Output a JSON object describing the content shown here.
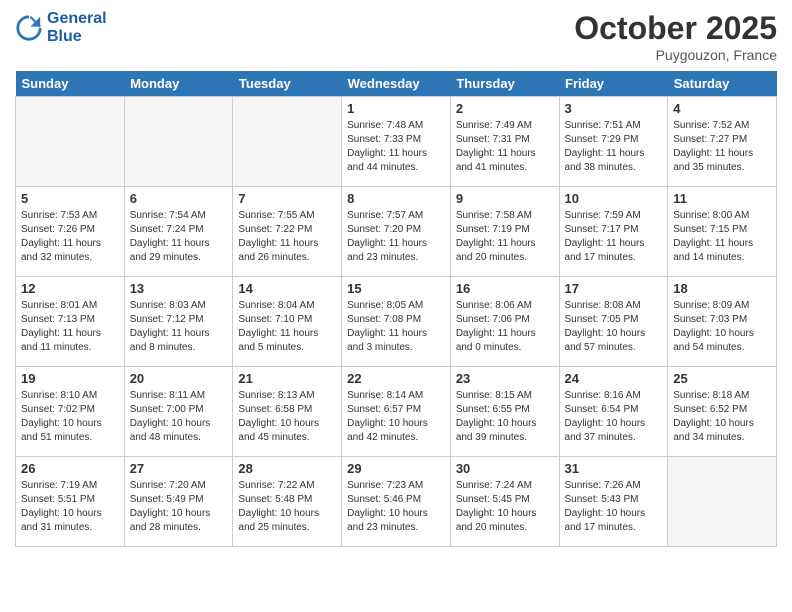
{
  "header": {
    "logo_line1": "General",
    "logo_line2": "Blue",
    "month": "October 2025",
    "location": "Puygouzon, France"
  },
  "days_of_week": [
    "Sunday",
    "Monday",
    "Tuesday",
    "Wednesday",
    "Thursday",
    "Friday",
    "Saturday"
  ],
  "weeks": [
    [
      {
        "day": "",
        "info": ""
      },
      {
        "day": "",
        "info": ""
      },
      {
        "day": "",
        "info": ""
      },
      {
        "day": "1",
        "info": "Sunrise: 7:48 AM\nSunset: 7:33 PM\nDaylight: 11 hours\nand 44 minutes."
      },
      {
        "day": "2",
        "info": "Sunrise: 7:49 AM\nSunset: 7:31 PM\nDaylight: 11 hours\nand 41 minutes."
      },
      {
        "day": "3",
        "info": "Sunrise: 7:51 AM\nSunset: 7:29 PM\nDaylight: 11 hours\nand 38 minutes."
      },
      {
        "day": "4",
        "info": "Sunrise: 7:52 AM\nSunset: 7:27 PM\nDaylight: 11 hours\nand 35 minutes."
      }
    ],
    [
      {
        "day": "5",
        "info": "Sunrise: 7:53 AM\nSunset: 7:26 PM\nDaylight: 11 hours\nand 32 minutes."
      },
      {
        "day": "6",
        "info": "Sunrise: 7:54 AM\nSunset: 7:24 PM\nDaylight: 11 hours\nand 29 minutes."
      },
      {
        "day": "7",
        "info": "Sunrise: 7:55 AM\nSunset: 7:22 PM\nDaylight: 11 hours\nand 26 minutes."
      },
      {
        "day": "8",
        "info": "Sunrise: 7:57 AM\nSunset: 7:20 PM\nDaylight: 11 hours\nand 23 minutes."
      },
      {
        "day": "9",
        "info": "Sunrise: 7:58 AM\nSunset: 7:19 PM\nDaylight: 11 hours\nand 20 minutes."
      },
      {
        "day": "10",
        "info": "Sunrise: 7:59 AM\nSunset: 7:17 PM\nDaylight: 11 hours\nand 17 minutes."
      },
      {
        "day": "11",
        "info": "Sunrise: 8:00 AM\nSunset: 7:15 PM\nDaylight: 11 hours\nand 14 minutes."
      }
    ],
    [
      {
        "day": "12",
        "info": "Sunrise: 8:01 AM\nSunset: 7:13 PM\nDaylight: 11 hours\nand 11 minutes."
      },
      {
        "day": "13",
        "info": "Sunrise: 8:03 AM\nSunset: 7:12 PM\nDaylight: 11 hours\nand 8 minutes."
      },
      {
        "day": "14",
        "info": "Sunrise: 8:04 AM\nSunset: 7:10 PM\nDaylight: 11 hours\nand 5 minutes."
      },
      {
        "day": "15",
        "info": "Sunrise: 8:05 AM\nSunset: 7:08 PM\nDaylight: 11 hours\nand 3 minutes."
      },
      {
        "day": "16",
        "info": "Sunrise: 8:06 AM\nSunset: 7:06 PM\nDaylight: 11 hours\nand 0 minutes."
      },
      {
        "day": "17",
        "info": "Sunrise: 8:08 AM\nSunset: 7:05 PM\nDaylight: 10 hours\nand 57 minutes."
      },
      {
        "day": "18",
        "info": "Sunrise: 8:09 AM\nSunset: 7:03 PM\nDaylight: 10 hours\nand 54 minutes."
      }
    ],
    [
      {
        "day": "19",
        "info": "Sunrise: 8:10 AM\nSunset: 7:02 PM\nDaylight: 10 hours\nand 51 minutes."
      },
      {
        "day": "20",
        "info": "Sunrise: 8:11 AM\nSunset: 7:00 PM\nDaylight: 10 hours\nand 48 minutes."
      },
      {
        "day": "21",
        "info": "Sunrise: 8:13 AM\nSunset: 6:58 PM\nDaylight: 10 hours\nand 45 minutes."
      },
      {
        "day": "22",
        "info": "Sunrise: 8:14 AM\nSunset: 6:57 PM\nDaylight: 10 hours\nand 42 minutes."
      },
      {
        "day": "23",
        "info": "Sunrise: 8:15 AM\nSunset: 6:55 PM\nDaylight: 10 hours\nand 39 minutes."
      },
      {
        "day": "24",
        "info": "Sunrise: 8:16 AM\nSunset: 6:54 PM\nDaylight: 10 hours\nand 37 minutes."
      },
      {
        "day": "25",
        "info": "Sunrise: 8:18 AM\nSunset: 6:52 PM\nDaylight: 10 hours\nand 34 minutes."
      }
    ],
    [
      {
        "day": "26",
        "info": "Sunrise: 7:19 AM\nSunset: 5:51 PM\nDaylight: 10 hours\nand 31 minutes."
      },
      {
        "day": "27",
        "info": "Sunrise: 7:20 AM\nSunset: 5:49 PM\nDaylight: 10 hours\nand 28 minutes."
      },
      {
        "day": "28",
        "info": "Sunrise: 7:22 AM\nSunset: 5:48 PM\nDaylight: 10 hours\nand 25 minutes."
      },
      {
        "day": "29",
        "info": "Sunrise: 7:23 AM\nSunset: 5:46 PM\nDaylight: 10 hours\nand 23 minutes."
      },
      {
        "day": "30",
        "info": "Sunrise: 7:24 AM\nSunset: 5:45 PM\nDaylight: 10 hours\nand 20 minutes."
      },
      {
        "day": "31",
        "info": "Sunrise: 7:26 AM\nSunset: 5:43 PM\nDaylight: 10 hours\nand 17 minutes."
      },
      {
        "day": "",
        "info": ""
      }
    ]
  ]
}
